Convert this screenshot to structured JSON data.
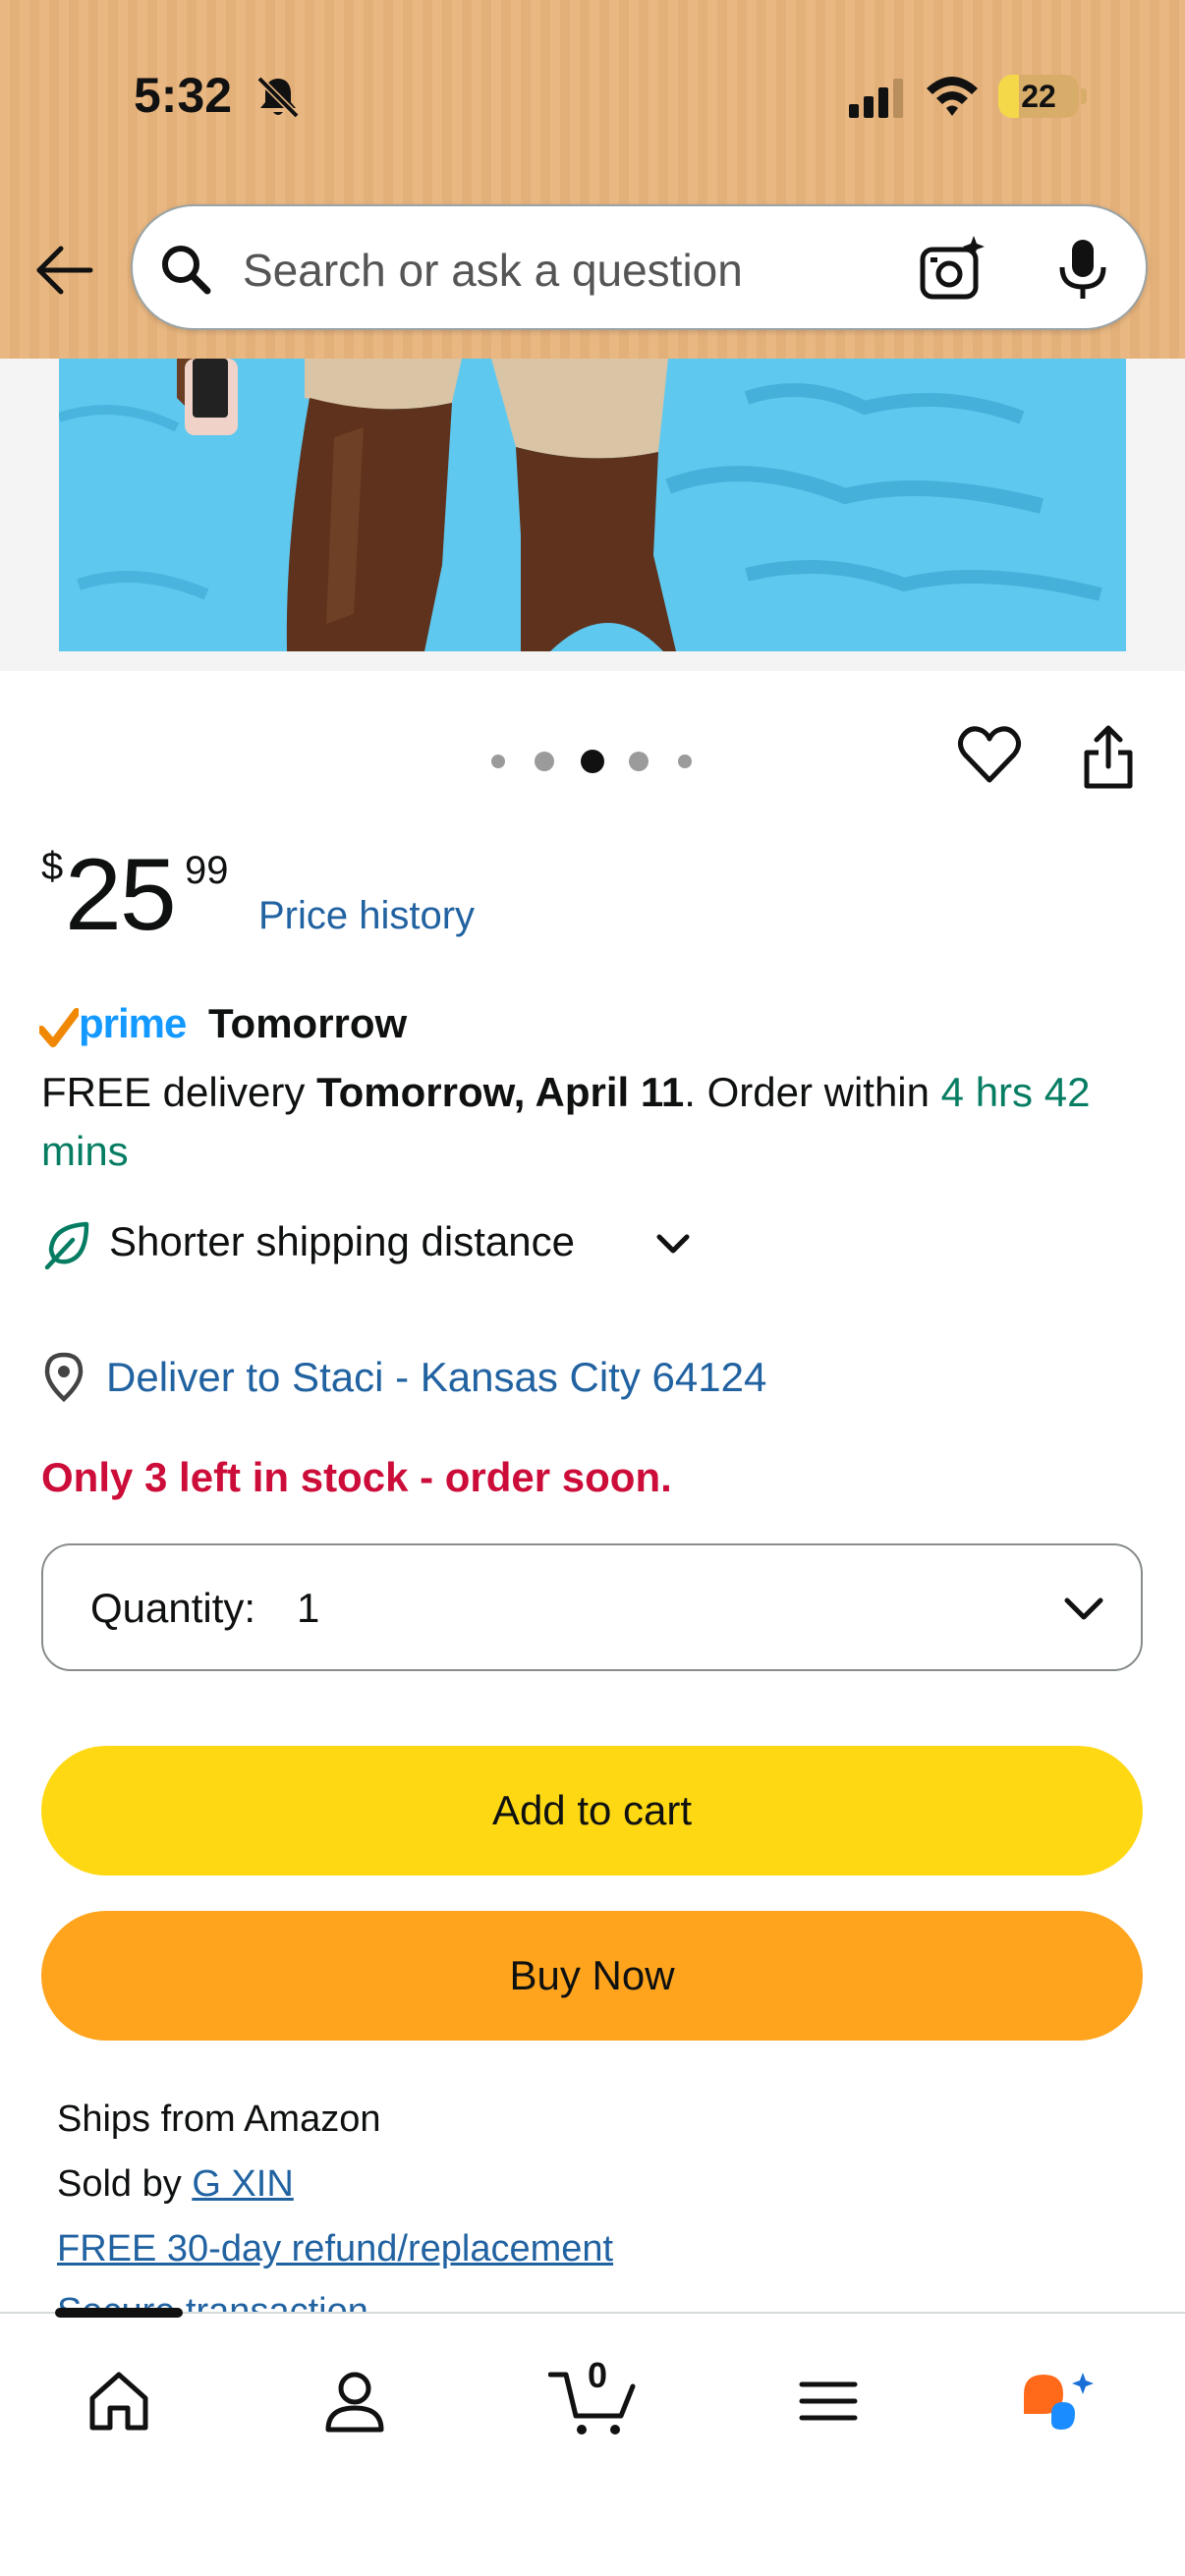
{
  "status_bar": {
    "time": "5:32",
    "battery": "22"
  },
  "search": {
    "placeholder": "Search or ask a question"
  },
  "carousel": {
    "count": 5,
    "active_index": 2
  },
  "price": {
    "currency": "$",
    "whole": "25",
    "fraction": "99",
    "history_link": "Price history"
  },
  "prime": {
    "brand": "prime",
    "when": "Tomorrow"
  },
  "delivery": {
    "prefix": "FREE delivery ",
    "date": "Tomorrow, April 11",
    "middle": ". Order within ",
    "countdown": "4 hrs 42 mins"
  },
  "shipping": {
    "label": "Shorter shipping distance"
  },
  "location": {
    "label": "Deliver to Staci - Kansas City 64124"
  },
  "stock": {
    "message": "Only 3 left in stock - order soon."
  },
  "quantity": {
    "label": "Quantity:",
    "value": "1"
  },
  "buttons": {
    "add_to_cart": "Add to cart",
    "buy_now": "Buy Now"
  },
  "seller": {
    "ships_from": "Ships from Amazon",
    "sold_by_prefix": "Sold by ",
    "sold_by_name": "G XIN",
    "refund": "FREE 30-day refund/replacement",
    "secure": "Secure transaction"
  },
  "nav": {
    "cart_count": "0"
  },
  "colors": {
    "header": "#e9b882",
    "add_to_cart": "#ffd814",
    "buy_now": "#ffa41c",
    "link": "#2162a1",
    "stock_red": "#cc0c39",
    "countdown_green": "#067d62"
  }
}
